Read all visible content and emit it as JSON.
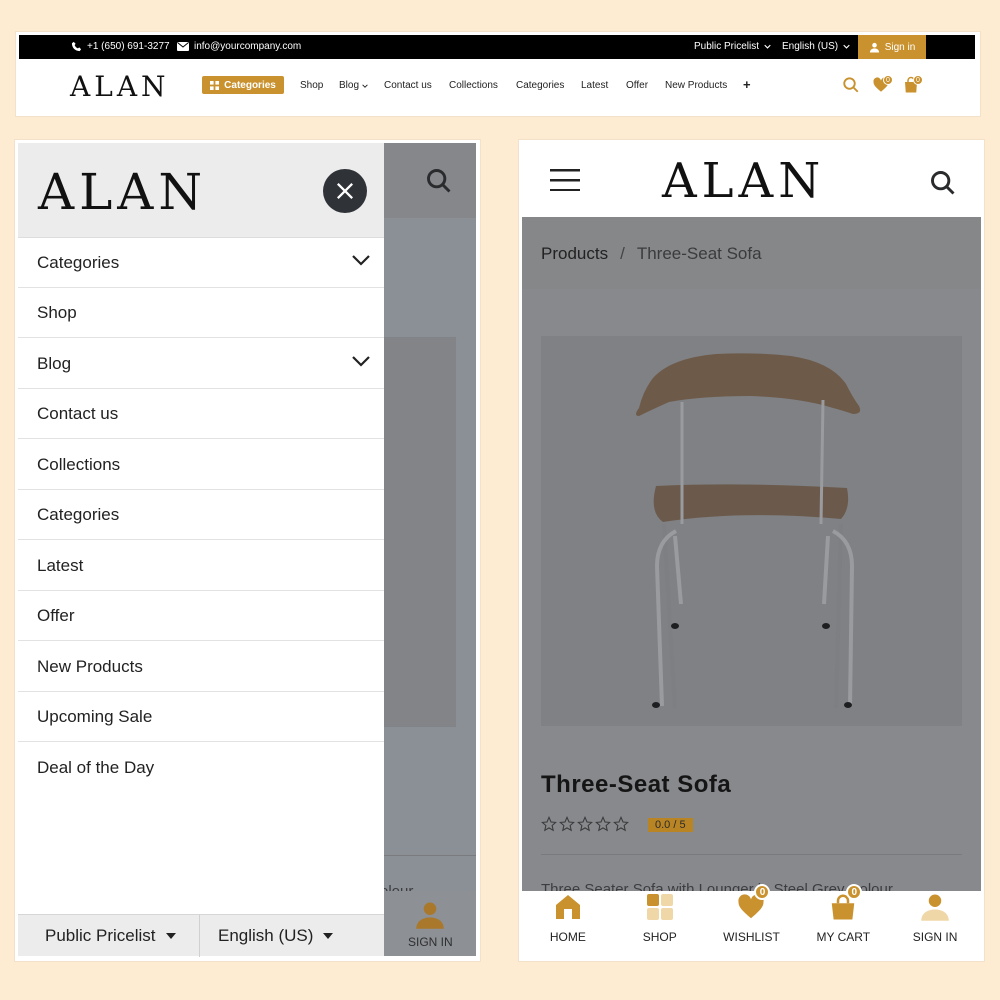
{
  "desktop": {
    "phone": "+1 (650) 691-3277",
    "email": "info@yourcompany.com",
    "pricelist": "Public Pricelist",
    "language": "English (US)",
    "sign_in": "Sign in",
    "logo": "ALAN",
    "categories_button": "Categories",
    "nav": [
      "Shop",
      "Blog",
      "Contact us",
      "Collections",
      "Categories",
      "Latest",
      "Offer",
      "New Products",
      "+"
    ],
    "wishlist_count": "0",
    "cart_count": "0"
  },
  "drawer": {
    "logo": "ALAN",
    "items": [
      "Categories",
      "Shop",
      "Blog",
      "Contact us",
      "Collections",
      "Categories",
      "Latest",
      "Offer",
      "New Products",
      "Upcoming Sale",
      "Deal of the Day"
    ],
    "pricelist": "Public Pricelist",
    "language": "English (US)",
    "sign_in_behind": "SIGN IN",
    "partial_text": "olour"
  },
  "product": {
    "logo": "ALAN",
    "breadcrumb": {
      "parent": "Products",
      "separator": "/",
      "current": "Three-Seat Sofa"
    },
    "title": "Three-Seat Sofa",
    "rating": "0.0 / 5",
    "description": "Three Seater Sofa with Lounger in Steel Grey Colour",
    "bottom_nav": {
      "home": "HOME",
      "shop": "SHOP",
      "wishlist": "WISHLIST",
      "cart": "MY CART",
      "sign_in": "SIGN IN",
      "wishlist_count": "0",
      "cart_count": "0"
    }
  },
  "colors": {
    "accent": "#c9922e",
    "overlay": "#87898d",
    "background": "#fdebd2"
  }
}
